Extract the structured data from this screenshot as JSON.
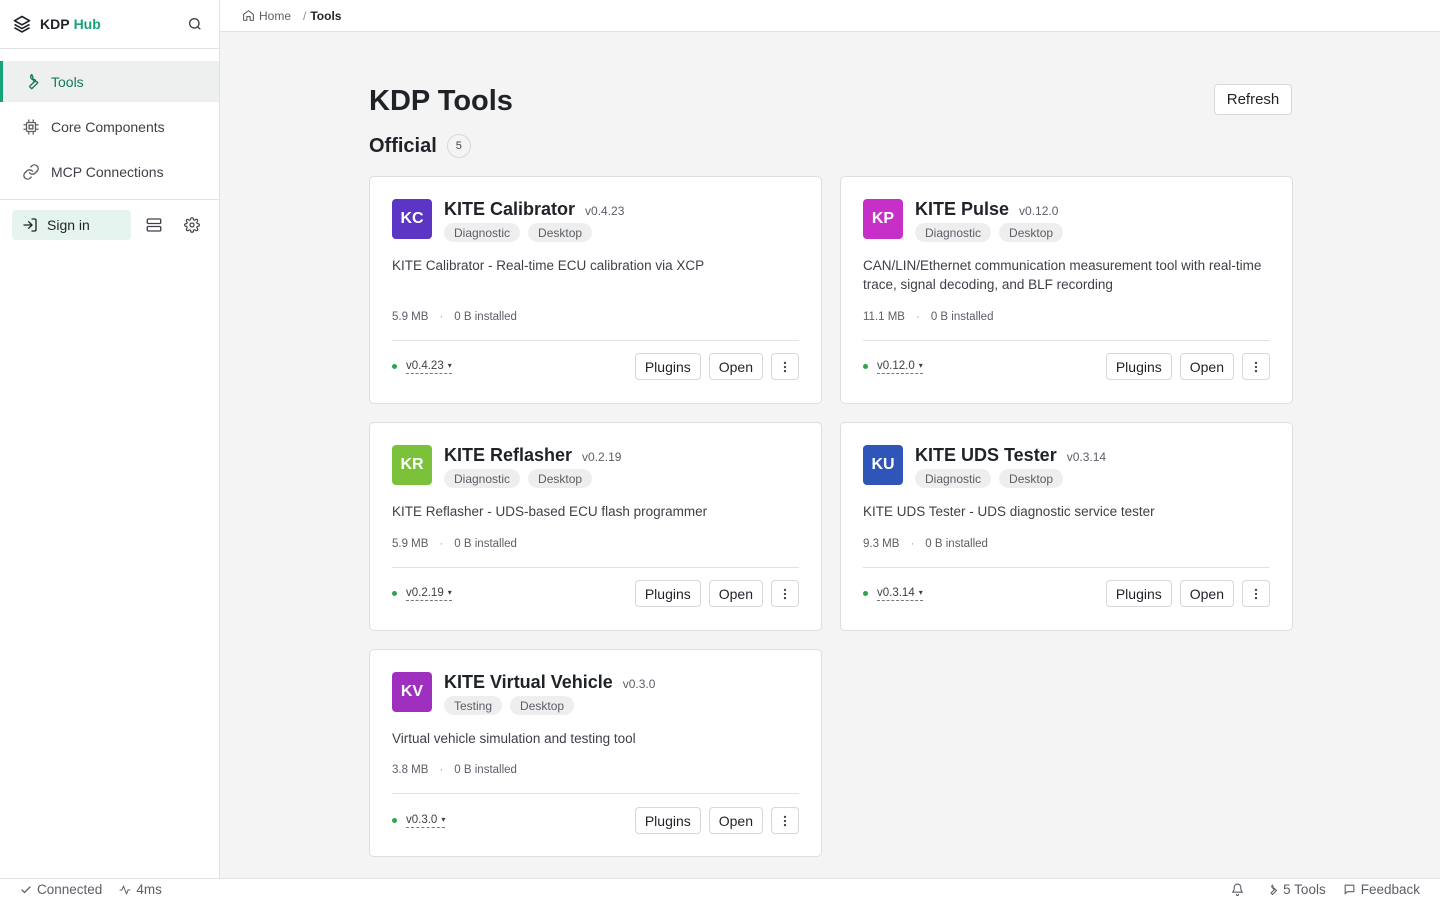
{
  "brand": {
    "name": "KDP",
    "accent": "Hub"
  },
  "sidebar": {
    "items": [
      {
        "label": "Tools",
        "icon": "wrench-icon",
        "active": true
      },
      {
        "label": "Core Components",
        "icon": "chip-icon",
        "active": false
      },
      {
        "label": "MCP Connections",
        "icon": "link-icon",
        "active": false
      }
    ],
    "sign_in": "Sign in"
  },
  "breadcrumb": {
    "home": "Home",
    "separator": "/",
    "current": "Tools"
  },
  "page": {
    "title": "KDP Tools",
    "refresh": "Refresh"
  },
  "section": {
    "title": "Official",
    "count": "5"
  },
  "tools": [
    {
      "initials": "KC",
      "name": "KITE Calibrator",
      "version": "v0.4.23",
      "tags": [
        "Diagnostic",
        "Desktop"
      ],
      "description": "KITE Calibrator - Real-time ECU calibration via XCP",
      "size": "5.9 MB",
      "installed": "0 B installed",
      "selected_version": "v0.4.23",
      "color": "#5b35c4"
    },
    {
      "initials": "KP",
      "name": "KITE Pulse",
      "version": "v0.12.0",
      "tags": [
        "Diagnostic",
        "Desktop"
      ],
      "description": "CAN/LIN/Ethernet communication measurement tool with real-time trace, signal decoding, and BLF recording",
      "size": "11.1 MB",
      "installed": "0 B installed",
      "selected_version": "v0.12.0",
      "color": "#c62fc8"
    },
    {
      "initials": "KR",
      "name": "KITE Reflasher",
      "version": "v0.2.19",
      "tags": [
        "Diagnostic",
        "Desktop"
      ],
      "description": "KITE Reflasher - UDS-based ECU flash programmer",
      "size": "5.9 MB",
      "installed": "0 B installed",
      "selected_version": "v0.2.19",
      "color": "#7bc23a"
    },
    {
      "initials": "KU",
      "name": "KITE UDS Tester",
      "version": "v0.3.14",
      "tags": [
        "Diagnostic",
        "Desktop"
      ],
      "description": "KITE UDS Tester - UDS diagnostic service tester",
      "size": "9.3 MB",
      "installed": "0 B installed",
      "selected_version": "v0.3.14",
      "color": "#2f55b8"
    },
    {
      "initials": "KV",
      "name": "KITE Virtual Vehicle",
      "version": "v0.3.0",
      "tags": [
        "Testing",
        "Desktop"
      ],
      "description": "Virtual vehicle simulation and testing tool",
      "size": "3.8 MB",
      "installed": "0 B installed",
      "selected_version": "v0.3.0",
      "color": "#9e2fbf"
    }
  ],
  "card_actions": {
    "plugins": "Plugins",
    "open": "Open"
  },
  "statusbar": {
    "connection": "Connected",
    "latency": "4ms",
    "tools_count": "5 Tools",
    "feedback": "Feedback"
  }
}
